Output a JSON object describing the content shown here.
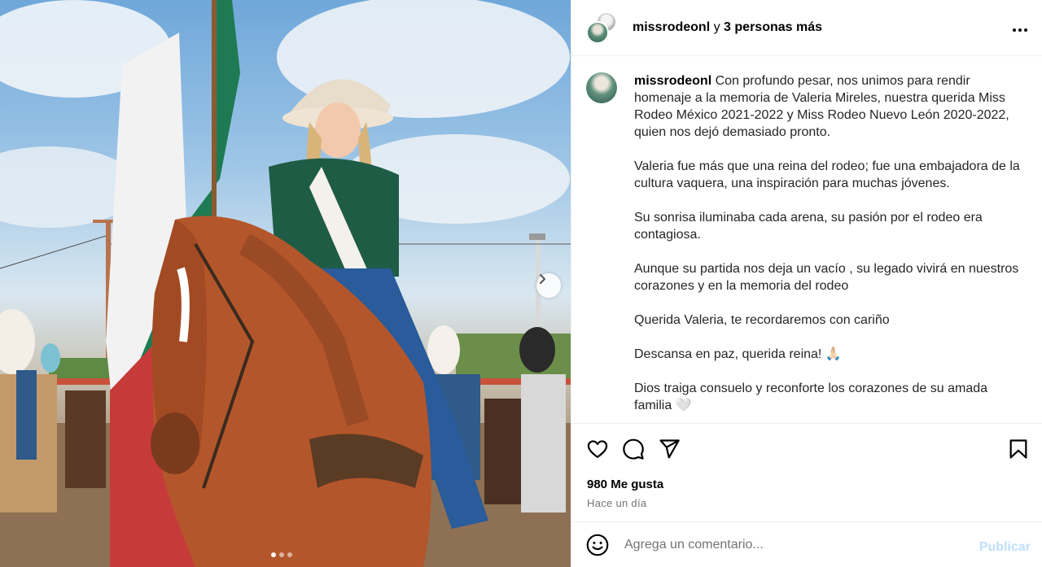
{
  "post": {
    "header": {
      "username": "missrodeonl",
      "connector": "y",
      "others": "3 personas más",
      "more_icon": "more-horizontal-icon"
    },
    "caption": {
      "username": "missrodeonl",
      "paragraphs": [
        "Con profundo pesar, nos unimos para rendir homenaje a la memoria de Valeria Mireles, nuestra querida Miss Rodeo México 2021-2022 y Miss Rodeo Nuevo León 2020-2022, quien nos dejó demasiado pronto.",
        "Valeria fue más que una reina del rodeo; fue una embajadora de la cultura vaquera, una inspiración para muchas jóvenes.",
        "Su sonrisa iluminaba cada arena, su pasión por el rodeo era contagiosa.",
        "Aunque su partida nos deja un vacío , su legado vivirá en nuestros corazones y en la memoria del rodeo",
        "Querida Valeria, te recordaremos con cariño",
        "Descansa en paz, querida reina! 🙏🏻",
        "Dios traiga consuelo y reconforte los corazones de su amada familia 🤍"
      ]
    },
    "media": {
      "carousel_count": 3,
      "carousel_active_index": 0,
      "next_icon": "chevron-right-icon"
    },
    "actions": {
      "like_icon": "heart-icon",
      "comment_icon": "comment-icon",
      "share_icon": "send-icon",
      "save_icon": "bookmark-icon"
    },
    "likes": "980 Me gusta",
    "time": "Hace un día",
    "comment_box": {
      "emoji_icon": "emoji-icon",
      "placeholder": "Agrega un comentario...",
      "publish_label": "Publicar"
    }
  },
  "colors": {
    "publish_disabled": "#c0dffd",
    "secondary_text": "#737373",
    "divider": "#efefef"
  }
}
